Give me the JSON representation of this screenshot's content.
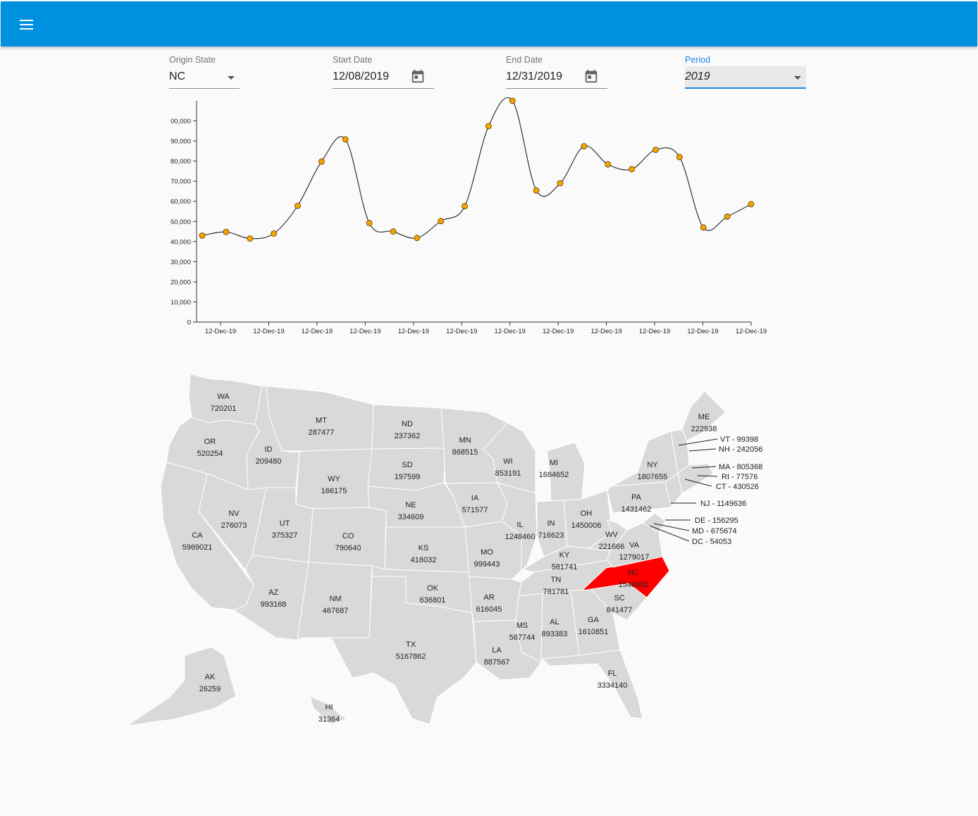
{
  "appbar": {
    "menu_icon": "hamburger-menu-icon",
    "color": "#0090e0"
  },
  "filters": {
    "origin_state": {
      "label": "Origin State",
      "value": "NC"
    },
    "start_date": {
      "label": "Start Date",
      "value": "12/08/2019"
    },
    "end_date": {
      "label": "End Date",
      "value": "12/31/2019"
    },
    "period": {
      "label": "Period",
      "value": "2019"
    }
  },
  "chart_data": {
    "type": "line",
    "ylim": [
      0,
      110000
    ],
    "y_ticks": [
      0,
      10000,
      20000,
      30000,
      40000,
      50000,
      60000,
      70000,
      80000,
      90000,
      100000
    ],
    "y_tick_labels": [
      "0",
      "10,000",
      "20,000",
      "30,000",
      "40,000",
      "50,000",
      "60,000",
      "70,000",
      "80,000",
      "90,000",
      "00,000"
    ],
    "x_tick_labels": [
      "12-Dec-19",
      "12-Dec-19",
      "12-Dec-19",
      "12-Dec-19",
      "12-Dec-19",
      "12-Dec-19",
      "12-Dec-19",
      "12-Dec-19",
      "12-Dec-19",
      "12-Dec-19",
      "12-Dec-19",
      "12-Dec-19"
    ],
    "values": [
      43000,
      44800,
      41500,
      44000,
      57800,
      79800,
      90800,
      49200,
      45000,
      41800,
      50200,
      57600,
      97400,
      110000,
      65400,
      69000,
      87400,
      78400,
      76000,
      85600,
      82000,
      47000,
      52400,
      58600
    ],
    "line_color": "#222222",
    "marker_color": "#f5a500",
    "grid": false
  },
  "map": {
    "states": [
      {
        "code": "WA",
        "value": "720201"
      },
      {
        "code": "OR",
        "value": "520254"
      },
      {
        "code": "CA",
        "value": "5969021"
      },
      {
        "code": "ID",
        "value": "209480"
      },
      {
        "code": "NV",
        "value": "276073"
      },
      {
        "code": "MT",
        "value": "287477"
      },
      {
        "code": "WY",
        "value": "166175"
      },
      {
        "code": "UT",
        "value": "375327"
      },
      {
        "code": "AZ",
        "value": "993168"
      },
      {
        "code": "CO",
        "value": "790640"
      },
      {
        "code": "NM",
        "value": "467687"
      },
      {
        "code": "ND",
        "value": "237362"
      },
      {
        "code": "SD",
        "value": "197599"
      },
      {
        "code": "NE",
        "value": "334609"
      },
      {
        "code": "KS",
        "value": "418032"
      },
      {
        "code": "OK",
        "value": "636801"
      },
      {
        "code": "TX",
        "value": "5167862"
      },
      {
        "code": "MN",
        "value": "868515"
      },
      {
        "code": "IA",
        "value": "571577"
      },
      {
        "code": "MO",
        "value": "999443"
      },
      {
        "code": "AR",
        "value": "616045"
      },
      {
        "code": "LA",
        "value": "887567"
      },
      {
        "code": "WI",
        "value": "853191"
      },
      {
        "code": "IL",
        "value": "1248460"
      },
      {
        "code": "MI",
        "value": "1684652"
      },
      {
        "code": "IN",
        "value": "716623"
      },
      {
        "code": "OH",
        "value": "1450006"
      },
      {
        "code": "KY",
        "value": "581741"
      },
      {
        "code": "TN",
        "value": "781781"
      },
      {
        "code": "MS",
        "value": "567744"
      },
      {
        "code": "AL",
        "value": "893383"
      },
      {
        "code": "GA",
        "value": "1610851"
      },
      {
        "code": "FL",
        "value": "3334140"
      },
      {
        "code": "SC",
        "value": "841477"
      },
      {
        "code": "NC",
        "value": "1548692"
      },
      {
        "code": "VA",
        "value": "1279017"
      },
      {
        "code": "WV",
        "value": "221666"
      },
      {
        "code": "PA",
        "value": "1431462"
      },
      {
        "code": "NY",
        "value": "1807655"
      },
      {
        "code": "ME",
        "value": "222938"
      },
      {
        "code": "AK",
        "value": "26259"
      },
      {
        "code": "HI",
        "value": "31364"
      }
    ],
    "callouts": [
      {
        "label": "VT - 99398"
      },
      {
        "label": "NH - 242056"
      },
      {
        "label": "MA - 805368"
      },
      {
        "label": "RI - 77576"
      },
      {
        "label": "CT - 430526"
      },
      {
        "label": "NJ - 1149636"
      },
      {
        "label": "DE - 156295"
      },
      {
        "label": "MD - 675674"
      },
      {
        "label": "DC - 54053"
      }
    ],
    "selected_state": "NC",
    "selected_color": "#ff0000",
    "state_fill": "#d9d9d9",
    "border_color": "#ffffff"
  }
}
